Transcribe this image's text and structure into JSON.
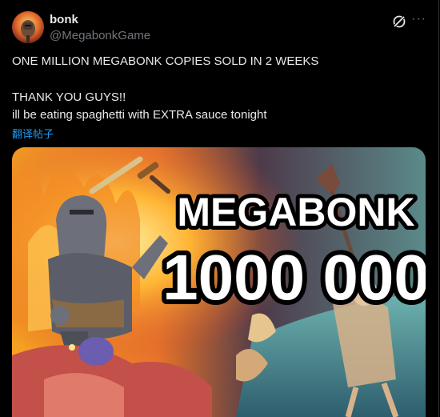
{
  "author": {
    "name": "bonk",
    "handle": "@MegabonkGame"
  },
  "header": {
    "grok_icon": "grok-icon",
    "more_icon": "more-icon",
    "more_label": "···"
  },
  "post": {
    "line1": "ONE MILLION MEGABONK COPIES SOLD IN 2 WEEKS",
    "line2": "THANK YOU GUYS!!",
    "line3": "ill be eating spaghetti with EXTRA sauce tonight",
    "translate": "翻译帖子"
  },
  "media": {
    "title": "MEGABONK",
    "count": "1000 000"
  },
  "colors": {
    "background": "#000000",
    "text": "#e7e9ea",
    "muted": "#71767b",
    "link": "#1d9bf0"
  }
}
